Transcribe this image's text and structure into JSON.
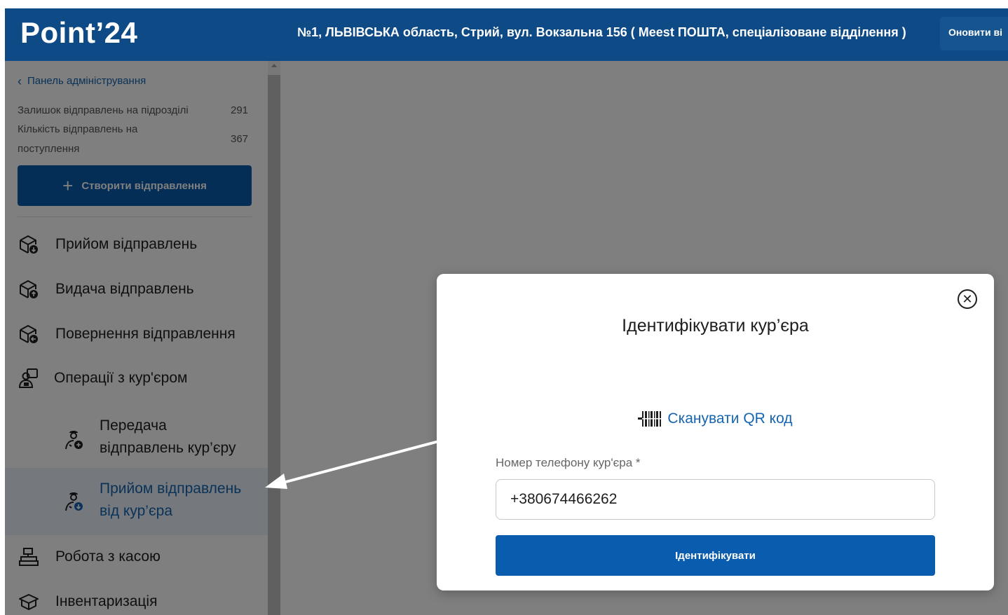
{
  "header": {
    "logo": "Point’24",
    "address": "№1, ЛЬВІВСЬКА область, Стрий, вул. Вокзальна 156 ( Meest ПОШТА, спеціалізоване відділення )",
    "refresh_label": "Оновити ві"
  },
  "sidebar": {
    "back_label": "Панель адміністрування",
    "stats": [
      {
        "label": "Залишок відправлень на підрозділі",
        "value": "291"
      },
      {
        "label_line1": "Кількість відправлень на",
        "label_line2": "поступлення",
        "value": "367"
      }
    ],
    "create_label": "Створити відправлення",
    "items": [
      {
        "label": "Прийом відправлень",
        "icon": "package-receive-icon"
      },
      {
        "label": "Видача відправлень",
        "icon": "package-issue-icon"
      },
      {
        "label": "Повернення відправлення",
        "icon": "package-return-icon"
      },
      {
        "label": "Операції з кур'єром",
        "icon": "courier-operations-icon"
      }
    ],
    "sub_items": [
      {
        "line1": "Передача",
        "line2": "відправлень кур’єру",
        "icon": "courier-send-icon"
      },
      {
        "line1": "Прийом відправлень",
        "line2": "від кур’єра",
        "icon": "courier-receive-icon",
        "active": true
      }
    ],
    "items_bottom": [
      {
        "label": "Робота з касою",
        "icon": "cash-register-icon"
      },
      {
        "label": "Інвентаризація",
        "icon": "inventory-icon"
      }
    ]
  },
  "modal": {
    "title": "Ідентифікувати кур’єра",
    "scan_label": "Сканувати QR код",
    "phone_label": "Номер телефону кур'єра *",
    "phone_value": "+380674466262",
    "submit_label": "Ідентифікувати"
  },
  "colors": {
    "header_bg": "#0e4a86",
    "primary": "#0a5cae",
    "link": "#1565b0",
    "active_bg": "#eaf3fb",
    "arrow": "#ffffff"
  }
}
